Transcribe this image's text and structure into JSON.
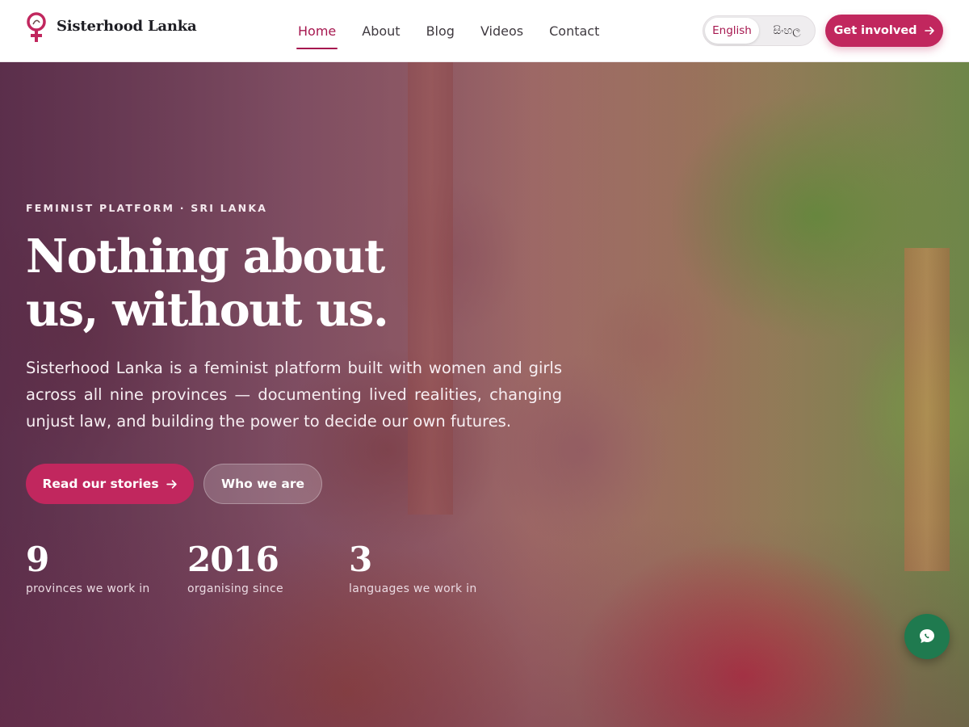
{
  "brand": {
    "name": "Sisterhood Lanka",
    "logo_icon": "venus-symbol-logo-icon",
    "logo_color": "#c1275e"
  },
  "nav": {
    "items": [
      {
        "label": "Home",
        "active": true
      },
      {
        "label": "About",
        "active": false
      },
      {
        "label": "Blog",
        "active": false
      },
      {
        "label": "Videos",
        "active": false
      },
      {
        "label": "Contact",
        "active": false
      }
    ]
  },
  "language": {
    "options": [
      "English",
      "සිංහල"
    ],
    "selected": "English"
  },
  "header_cta": {
    "label": "Get involved",
    "icon": "arrow-right-icon"
  },
  "hero": {
    "eyebrow": "FEMINIST PLATFORM · SRI LANKA",
    "headline_line1": "Nothing about",
    "headline_line2": "us, without us.",
    "intro": "Sisterhood Lanka is a feminist platform built with women and girls across all nine provinces — documenting lived realities, changing unjust law, and building the power to decide our own futures.",
    "primary_button": "Read our stories",
    "secondary_button": "Who we are",
    "stats": [
      {
        "value": "9",
        "label": "provinces we work in"
      },
      {
        "value": "2016",
        "label": "organising since"
      },
      {
        "value": "3",
        "label": "languages we work in"
      }
    ]
  },
  "chat": {
    "icon": "chat-bubble-icon"
  },
  "colors": {
    "accent": "#c1275e",
    "accent_text": "#a6174f",
    "chat": "#1f7a4f"
  }
}
